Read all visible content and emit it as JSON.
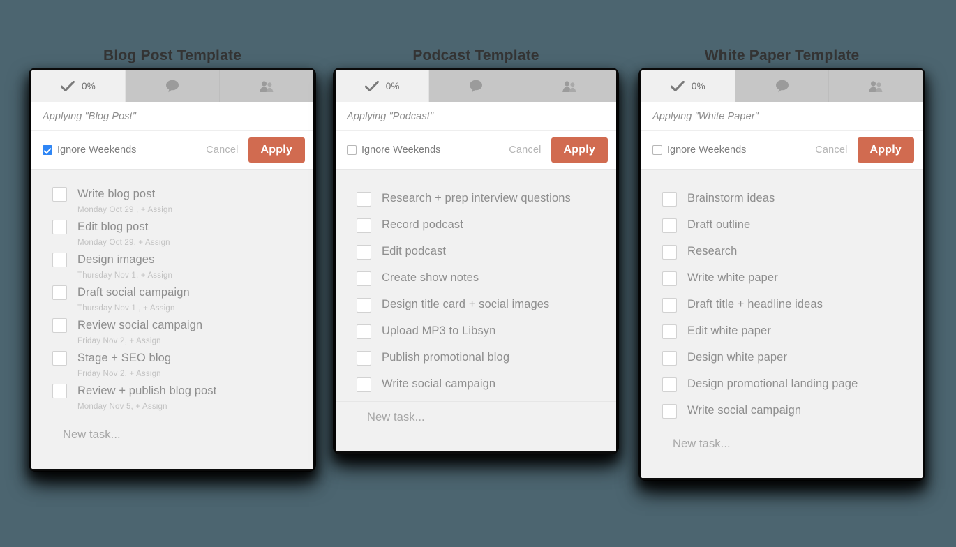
{
  "theme": {
    "page_background": "#4c6570",
    "accent_apply": "#d16b50",
    "checkbox_checked": "#2f86f5",
    "card_background": "#f1f1f1",
    "tab_active_background": "#f0f0f0",
    "tab_inactive_background": "#c6c6c6"
  },
  "common": {
    "tabs": [
      {
        "icon": "check-icon",
        "label": "0%"
      },
      {
        "icon": "comment-bubble-icon",
        "label": ""
      },
      {
        "icon": "users-icon",
        "label": ""
      }
    ],
    "ignore_weekends_label": "Ignore Weekends",
    "cancel_label": "Cancel",
    "apply_label": "Apply",
    "new_task_label": "New task...",
    "assign_label": "+ Assign"
  },
  "panels": [
    {
      "title": "Blog Post Template",
      "progress": "0%",
      "applying_text": "Applying \"Blog Post\"",
      "ignore_weekends_checked": true,
      "tasks": [
        {
          "name": "Write blog post",
          "meta": "Monday Oct 29 ,  + Assign"
        },
        {
          "name": "Edit blog post",
          "meta": "Monday Oct 29,  + Assign"
        },
        {
          "name": "Design images",
          "meta": "Thursday Nov 1,  + Assign"
        },
        {
          "name": "Draft social campaign",
          "meta": "Thursday Nov 1 ,  + Assign"
        },
        {
          "name": "Review social campaign",
          "meta": "Friday Nov 2,  + Assign"
        },
        {
          "name": "Stage + SEO blog",
          "meta": "Friday Nov 2,  + Assign"
        },
        {
          "name": "Review + publish blog post",
          "meta": "Monday Nov 5,  + Assign"
        }
      ]
    },
    {
      "title": "Podcast Template",
      "progress": "0%",
      "applying_text": "Applying \"Podcast\"",
      "ignore_weekends_checked": false,
      "tasks": [
        {
          "name": "Research + prep interview questions",
          "meta": ""
        },
        {
          "name": "Record podcast",
          "meta": ""
        },
        {
          "name": "Edit podcast",
          "meta": ""
        },
        {
          "name": "Create show notes",
          "meta": ""
        },
        {
          "name": "Design title card + social images",
          "meta": ""
        },
        {
          "name": "Upload MP3 to Libsyn",
          "meta": ""
        },
        {
          "name": "Publish promotional blog",
          "meta": ""
        },
        {
          "name": "Write social campaign",
          "meta": ""
        }
      ]
    },
    {
      "title": "White Paper Template",
      "progress": "0%",
      "applying_text": "Applying \"White Paper\"",
      "ignore_weekends_checked": false,
      "tasks": [
        {
          "name": "Brainstorm ideas",
          "meta": ""
        },
        {
          "name": "Draft outline",
          "meta": ""
        },
        {
          "name": "Research",
          "meta": ""
        },
        {
          "name": "Write white paper",
          "meta": ""
        },
        {
          "name": "Draft title + headline ideas",
          "meta": ""
        },
        {
          "name": "Edit white paper",
          "meta": ""
        },
        {
          "name": "Design white paper",
          "meta": ""
        },
        {
          "name": "Design promotional landing page",
          "meta": ""
        },
        {
          "name": "Write social campaign",
          "meta": ""
        }
      ]
    }
  ]
}
